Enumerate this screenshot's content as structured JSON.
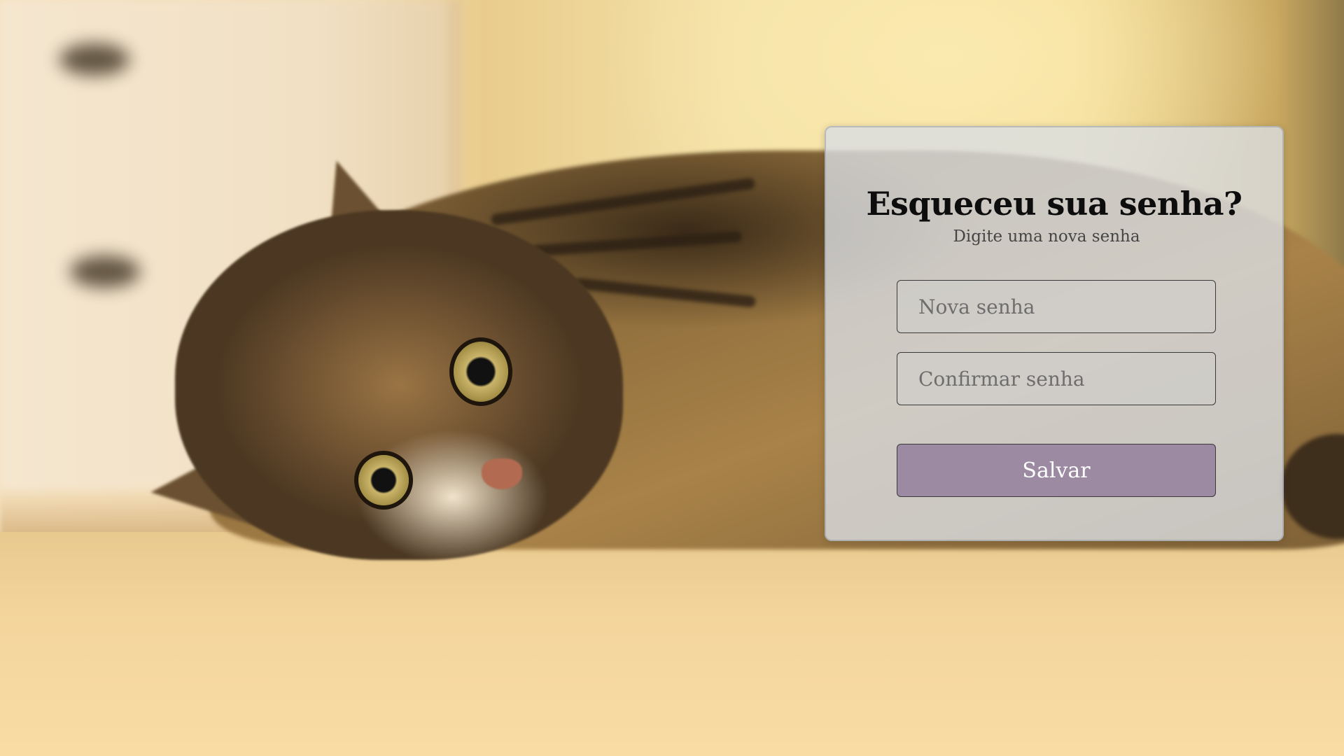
{
  "form": {
    "title": "Esqueceu sua senha?",
    "subtitle": "Digite uma nova senha",
    "new_password_placeholder": "Nova senha",
    "new_password_value": "",
    "confirm_password_placeholder": "Confirmar senha",
    "confirm_password_value": "",
    "save_label": "Salvar"
  },
  "colors": {
    "card_background": "#dadde2",
    "button_background": "#9b8aa1",
    "button_text": "#ffffff",
    "title_text": "#0d0d0d"
  },
  "background": {
    "subject": "cat-photo"
  }
}
